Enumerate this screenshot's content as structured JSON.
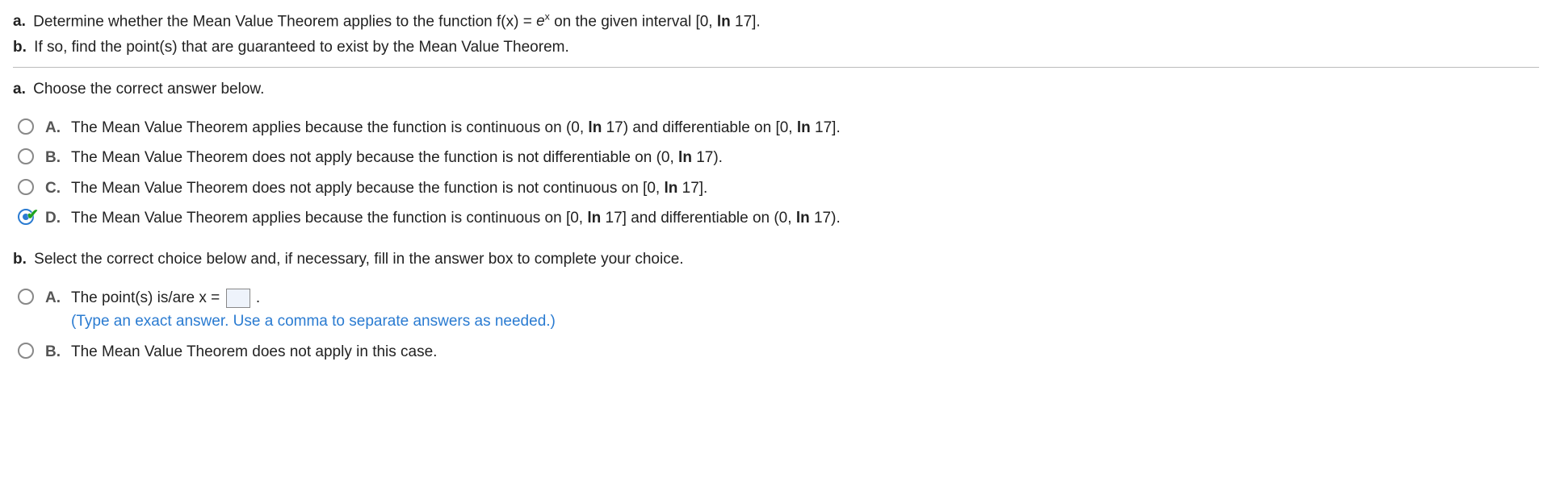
{
  "intro": {
    "a_label": "a.",
    "a_pre": " Determine whether the Mean Value Theorem applies to the function f(x) = ",
    "a_funcbase": "e",
    "a_sup": "x",
    "a_post": " on the given interval [0, ",
    "a_ln": "ln",
    "a_tail": " 17].",
    "b_label": "b.",
    "b_text": " If so, find the point(s) that are guaranteed to exist by the Mean Value Theorem."
  },
  "partA": {
    "label": "a.",
    "prompt": " Choose the correct answer below.",
    "choices": [
      {
        "letter": "A.",
        "pre": "The Mean Value Theorem applies because the function is continuous on (0, ",
        "ln1": "ln",
        "mid": " 17) and differentiable on [0, ",
        "ln2": "ln",
        "post": " 17].",
        "checked": false
      },
      {
        "letter": "B.",
        "pre": "The Mean Value Theorem does not apply because the function is not differentiable on (0, ",
        "ln1": "ln",
        "mid": " 17).",
        "ln2": "",
        "post": "",
        "checked": false
      },
      {
        "letter": "C.",
        "pre": "The Mean Value Theorem does not apply because the function is not continuous on [0, ",
        "ln1": "ln",
        "mid": " 17].",
        "ln2": "",
        "post": "",
        "checked": false
      },
      {
        "letter": "D.",
        "pre": "The Mean Value Theorem applies because the function is continuous on [0, ",
        "ln1": "ln",
        "mid": " 17] and differentiable on (0, ",
        "ln2": "ln",
        "post": " 17).",
        "checked": true
      }
    ]
  },
  "partB": {
    "label": "b.",
    "prompt": " Select the correct choice below and, if necessary, fill in the answer box to complete your choice.",
    "choiceA": {
      "letter": "A.",
      "pre": "The point(s) is/are x = ",
      "post": " .",
      "hint": "(Type an exact answer. Use a comma to separate answers as needed.)"
    },
    "choiceB": {
      "letter": "B.",
      "text": "The Mean Value Theorem does not apply in this case."
    }
  }
}
